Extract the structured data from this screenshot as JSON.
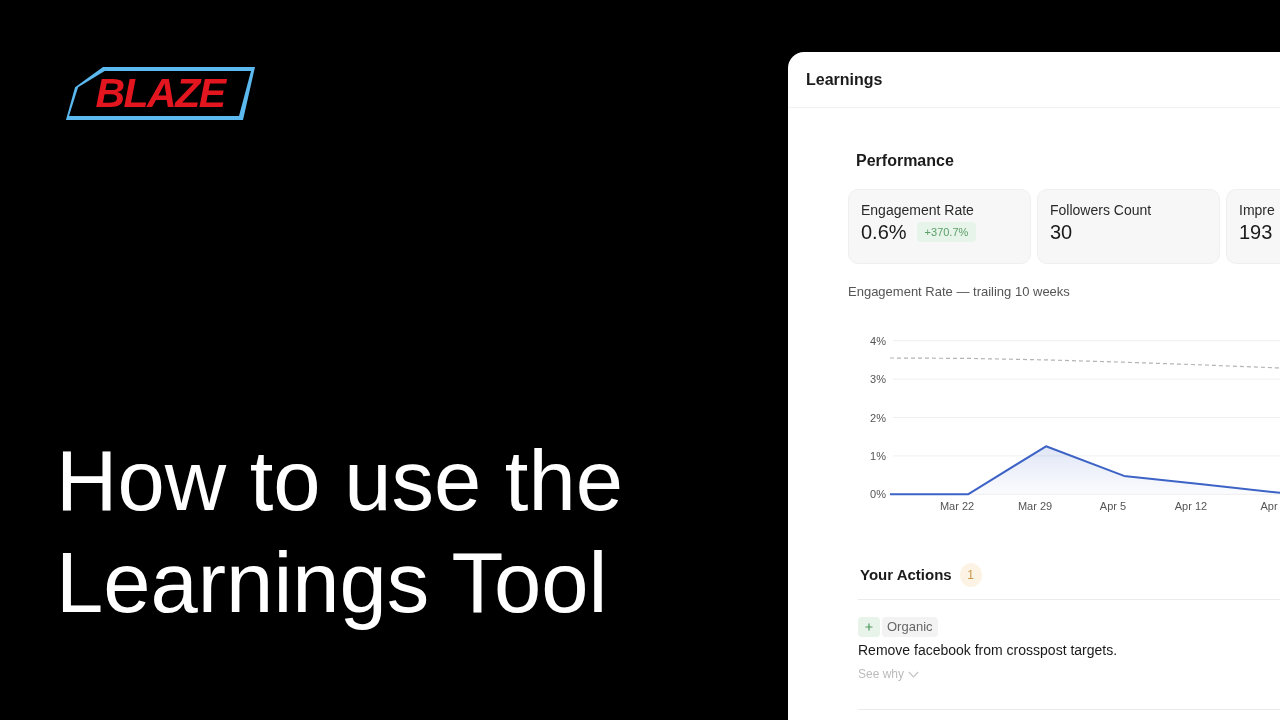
{
  "logo": {
    "text": "BLAZE"
  },
  "headline": "How to use the Learnings Tool",
  "panel": {
    "title": "Learnings",
    "performance": {
      "heading": "Performance",
      "metrics": [
        {
          "label": "Engagement Rate",
          "value": "0.6%",
          "change": "+370.7%"
        },
        {
          "label": "Followers Count",
          "value": "30"
        },
        {
          "label": "Impre",
          "value": "193"
        }
      ],
      "chart_data": {
        "type": "area",
        "title": "Engagement Rate — trailing 10 weeks",
        "categories": [
          null,
          "Mar 22",
          "Mar 29",
          "Apr 5",
          "Apr 12",
          "Apr"
        ],
        "ylim": [
          0,
          4
        ],
        "yticks": [
          {
            "value": 0,
            "label": "0%"
          },
          {
            "value": 1,
            "label": "1%"
          },
          {
            "value": 2,
            "label": "2%"
          },
          {
            "value": 3,
            "label": "3%"
          },
          {
            "value": 4,
            "label": "4%"
          }
        ],
        "grid": true,
        "series": [
          {
            "color": "#3d63c6",
            "line_style": "solid",
            "values": [
              0,
              0,
              1.25,
              0.48,
              0.26,
              0.04
            ]
          },
          {
            "type": "line",
            "color": "#b4b4b4",
            "line_style": "dashed",
            "values": [
              3.55,
              3.54,
              3.5,
              3.44,
              3.37,
              3.29
            ]
          }
        ]
      }
    },
    "actions": {
      "heading": "Your Actions",
      "count": "1",
      "items": [
        {
          "tag": "Organic",
          "text": "Remove facebook from crosspost targets.",
          "link": "See why"
        }
      ]
    }
  }
}
